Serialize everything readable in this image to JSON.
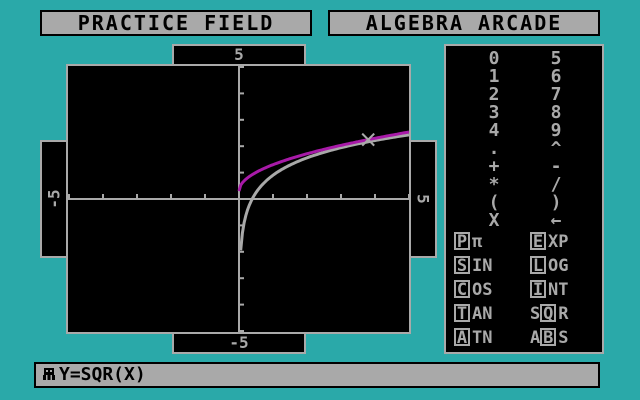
{
  "titles": {
    "left": "PRACTICE FIELD",
    "right": "ALGEBRA ARCADE"
  },
  "axis_labels": {
    "top": "5",
    "bottom": "-5",
    "left": "-5",
    "right": "5"
  },
  "keypad": {
    "digits_left": [
      "0",
      "1",
      "2",
      "3",
      "4"
    ],
    "digits_right": [
      "5",
      "6",
      "7",
      "8",
      "9"
    ],
    "symbols_left": [
      ".",
      "+",
      "*",
      "(",
      "X"
    ],
    "symbols_right": [
      "^",
      "-",
      "/",
      ")",
      "←"
    ],
    "functions": [
      {
        "box": "P",
        "rest": "π"
      },
      {
        "box": "E",
        "rest": "XP"
      },
      {
        "box": "S",
        "rest": "IN"
      },
      {
        "box": "L",
        "rest": "OG"
      },
      {
        "box": "C",
        "rest": "OS"
      },
      {
        "box": "I",
        "rest": "NT"
      },
      {
        "box": "T",
        "rest": "AN"
      },
      {
        "prefix": "S",
        "box": "Q",
        "rest": "R"
      },
      {
        "box": "A",
        "rest": "TN"
      },
      {
        "prefix": "A",
        "box": "B",
        "rest": "S"
      }
    ]
  },
  "status": {
    "expression": "Y=SQR(X)"
  },
  "colors": {
    "background": "#2aa9a9",
    "panel": "#a9a9a9",
    "curve_a": "#a81aa8",
    "curve_b": "#a9a9a9"
  },
  "graph": {
    "xrange": [
      -5,
      5
    ],
    "yrange": [
      -5,
      5
    ],
    "curve_magenta": "y = sqrt(x) + 0.3",
    "curve_gray": "y = log-shaped increasing curve",
    "marker_x": 3.8
  }
}
